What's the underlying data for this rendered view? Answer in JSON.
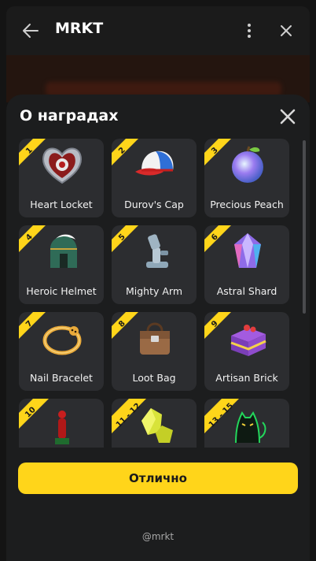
{
  "topbar": {
    "title": "MRKT",
    "back_icon": "arrow-left-icon",
    "menu_icon": "vertical-dots-icon",
    "close_icon": "close-icon"
  },
  "sheet": {
    "title": "О наградах",
    "close_icon": "close-icon"
  },
  "rewards": [
    {
      "num": "1",
      "label": "Heart Locket",
      "icon": "heart-locket-icon"
    },
    {
      "num": "2",
      "label": "Durov's Cap",
      "icon": "cap-icon"
    },
    {
      "num": "3",
      "label": "Precious Peach",
      "icon": "peach-icon"
    },
    {
      "num": "4",
      "label": "Heroic Helmet",
      "icon": "helmet-icon"
    },
    {
      "num": "5",
      "label": "Mighty Arm",
      "icon": "robot-arm-icon"
    },
    {
      "num": "6",
      "label": "Astral Shard",
      "icon": "crystal-icon"
    },
    {
      "num": "7",
      "label": "Nail Bracelet",
      "icon": "bracelet-icon"
    },
    {
      "num": "8",
      "label": "Loot Bag",
      "icon": "bag-icon"
    },
    {
      "num": "9",
      "label": "Artisan Brick",
      "icon": "cake-icon"
    },
    {
      "num": "10",
      "label": "",
      "icon": "oscar-statue-icon"
    },
    {
      "num": "11 - 12",
      "label": "",
      "icon": "yellow-gems-icon"
    },
    {
      "num": "13 - 15",
      "label": "",
      "icon": "neon-cat-icon"
    }
  ],
  "ok_button": "Отлично",
  "footer": "@mrkt",
  "colors": {
    "accent": "#ffd51a",
    "card": "#2c2d30",
    "sheet": "#1c1d1e"
  }
}
